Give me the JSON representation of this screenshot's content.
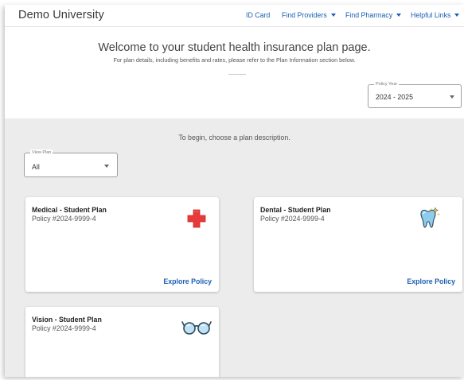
{
  "header": {
    "brand": "Demo University",
    "nav": [
      {
        "label": "ID Card",
        "has_menu": false
      },
      {
        "label": "Find Providers",
        "has_menu": true
      },
      {
        "label": "Find Pharmacy",
        "has_menu": true
      },
      {
        "label": "Helpful Links",
        "has_menu": true
      }
    ]
  },
  "hero": {
    "title": "Welcome to your student health insurance plan page.",
    "subtitle": "For plan details, including benefits and rates, please refer to the Plan Information section below."
  },
  "policy_year": {
    "legend": "Policy Year",
    "value": "2024 - 2025"
  },
  "plans_section": {
    "prompt": "To begin, choose a plan description.",
    "view_plan": {
      "legend": "View Plan",
      "value": "All"
    },
    "cards": [
      {
        "title": "Medical - Student Plan",
        "policy": "Policy #2024-9999-4",
        "cta": "Explore Policy",
        "icon": "medical-cross-icon"
      },
      {
        "title": "Dental - Student Plan",
        "policy": "Policy #2024-9999-4",
        "cta": "Explore Policy",
        "icon": "tooth-icon"
      },
      {
        "title": "Vision - Student Plan",
        "policy": "Policy #2024-9999-4",
        "cta": "",
        "icon": "glasses-icon"
      }
    ]
  },
  "colors": {
    "link": "#1c5fb2",
    "medical_red": "#e8393b",
    "tooth_blue": "#8fcbea",
    "panel_bg": "#ececec"
  }
}
